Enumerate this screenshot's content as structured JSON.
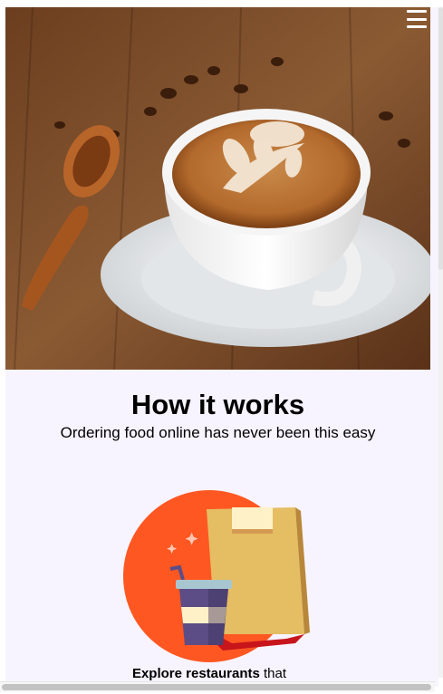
{
  "header": {
    "menu_icon": "hamburger-menu-icon",
    "hero_image": "latte-art-coffee-cup-photo"
  },
  "how_it_works": {
    "title": "How it works",
    "subtitle": "Ordering food online has never been this easy",
    "steps": [
      {
        "illustration": "takeaway-bag-and-drink-icon",
        "bold": "Explore restaurants",
        "rest": " that"
      }
    ]
  },
  "colors": {
    "page_background": "#f7f4ff",
    "illustration_circle": "#ff5722",
    "bag": "#e5bd62"
  }
}
